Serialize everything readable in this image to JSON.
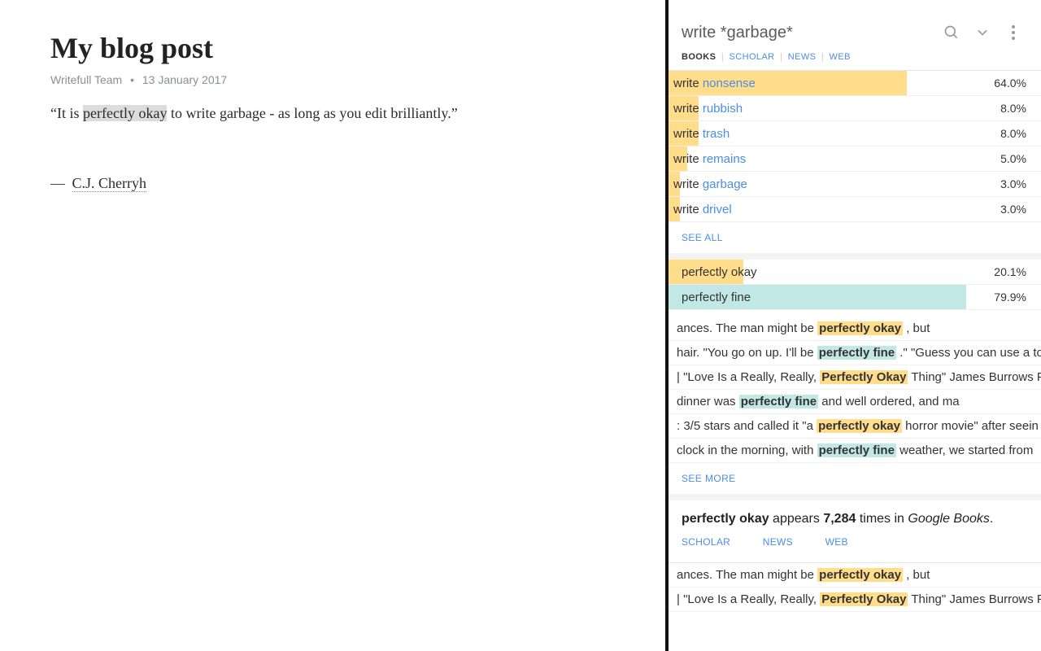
{
  "editor": {
    "title": "My blog post",
    "author": "Writefull Team",
    "date": "13 January 2017",
    "quote_pre": "“It is ",
    "quote_highlight": "perfectly okay",
    "quote_post": " to write garbage - as long as you edit brilliantly.”",
    "attribution_dash": "—",
    "attribution_name": "C.J. Cherryh"
  },
  "panel": {
    "search_value": "write *garbage*",
    "tabs": {
      "books": "BOOKS",
      "scholar": "SCHOLAR",
      "news": "NEWS",
      "web": "WEB"
    },
    "synonyms": [
      {
        "prefix": "write ",
        "word": "nonsense",
        "pct": "64.0%",
        "bar": 64
      },
      {
        "prefix": "write ",
        "word": "rubbish",
        "pct": "8.0%",
        "bar": 8
      },
      {
        "prefix": "write ",
        "word": "trash",
        "pct": "8.0%",
        "bar": 8
      },
      {
        "prefix": "write ",
        "word": "remains",
        "pct": "5.0%",
        "bar": 5
      },
      {
        "prefix": "write ",
        "word": "garbage",
        "pct": "3.0%",
        "bar": 3
      },
      {
        "prefix": "write ",
        "word": "drivel",
        "pct": "3.0%",
        "bar": 3
      }
    ],
    "see_all": "SEE ALL",
    "compare": [
      {
        "label": "perfectly okay",
        "pct": "20.1%",
        "bar": 20.1,
        "color": "gold"
      },
      {
        "label": "perfectly fine",
        "pct": "79.9%",
        "bar": 79.9,
        "color": "teal"
      }
    ],
    "examples": [
      {
        "pre": "ances. The man might be ",
        "hl": "perfectly okay",
        "post": " , but",
        "color": "gold"
      },
      {
        "pre": "hair. \"You go on up. I'll be ",
        "hl": "perfectly fine",
        "post": " .\" \"Guess you can use a to",
        "color": "teal"
      },
      {
        "pre": "| \"Love Is a Really, Really, ",
        "hl": "Perfectly Okay",
        "post": " Thing\" James Burrows Ph",
        "color": "gold"
      },
      {
        "pre": "dinner was ",
        "hl": "perfectly fine",
        "post": " and well ordered, and ma",
        "color": "teal"
      },
      {
        "pre": ": 3/5 stars and called it \"a ",
        "hl": "perfectly okay",
        "post": " horror movie\" after seein",
        "color": "gold"
      },
      {
        "pre": "clock in the morning, with ",
        "hl": "perfectly fine",
        "post": " weather, we started from",
        "color": "teal"
      }
    ],
    "see_more": "SEE MORE",
    "frequency": {
      "phrase": "perfectly okay",
      "verb": " appears ",
      "count": "7,284",
      "suffix": " times in ",
      "source": "Google Books",
      "period": "."
    },
    "freq_links": {
      "scholar": "SCHOLAR",
      "news": "NEWS",
      "web": "WEB"
    },
    "bottom_examples": [
      {
        "pre": "ances. The man might be ",
        "hl": "perfectly okay",
        "post": " , but",
        "color": "gold"
      },
      {
        "pre": "| \"Love Is a Really, Really, ",
        "hl": "Perfectly Okay",
        "post": " Thing\" James Burrows Ph",
        "color": "gold"
      }
    ]
  }
}
